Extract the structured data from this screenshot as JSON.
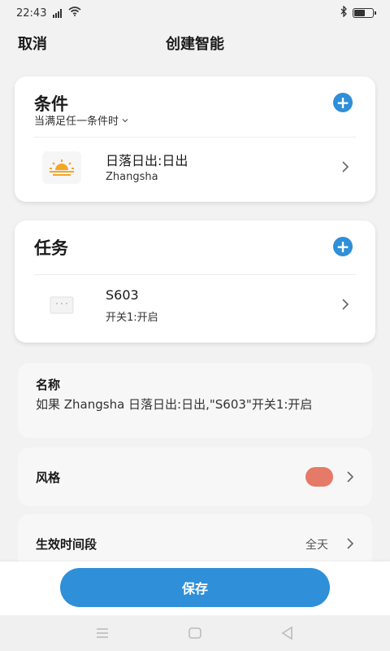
{
  "status_bar": {
    "time": "22:43"
  },
  "header": {
    "cancel_label": "取消",
    "title": "创建智能"
  },
  "conditions": {
    "title": "条件",
    "subtitle": "当满足任一条件时",
    "item": {
      "title": "日落日出:日出",
      "subtitle": "Zhangsha",
      "icon": "sunrise-icon"
    }
  },
  "tasks": {
    "title": "任务",
    "item": {
      "title": "S603",
      "subtitle": "开关1:开启",
      "icon": "switch-device-icon"
    }
  },
  "name": {
    "label": "名称",
    "value": "如果 Zhangsha 日落日出:日出,\"S603\"开关1:开启"
  },
  "style": {
    "label": "风格",
    "color": "#e57a68"
  },
  "period": {
    "label": "生效时间段",
    "value": "全天"
  },
  "save_label": "保存",
  "colors": {
    "accent": "#2f8fd8",
    "sun": "#f5a623"
  }
}
